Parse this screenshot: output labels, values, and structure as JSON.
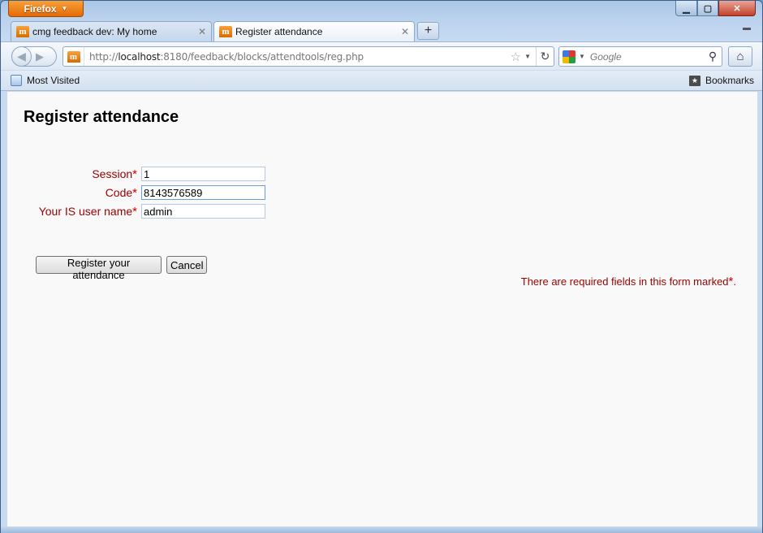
{
  "browser": {
    "menu_button": "Firefox",
    "tabs": [
      {
        "title": "cmg feedback dev: My home",
        "active": false
      },
      {
        "title": "Register attendance",
        "active": true
      }
    ],
    "new_tab_label": "+",
    "url": {
      "prefix": "http://",
      "host": "localhost",
      "rest": ":8180/feedback/blocks/attendtools/reg.php"
    },
    "search_placeholder": "Google",
    "bookmarks_toolbar": {
      "most_visited": "Most Visited",
      "bookmarks": "Bookmarks"
    }
  },
  "page": {
    "title": "Register attendance",
    "form": {
      "fields": [
        {
          "label": "Session",
          "value": "1"
        },
        {
          "label": "Code",
          "value": "8143576589"
        },
        {
          "label": "Your IS user name",
          "value": "admin"
        }
      ],
      "required_marker": "*",
      "submit_label": "Register your attendance",
      "cancel_label": "Cancel",
      "required_note": "There are required fields in this form marked",
      "required_note_end": "."
    }
  },
  "colors": {
    "required_text": "#990000",
    "required_marker": "#cc0000",
    "firefox_button": "#e66a05"
  },
  "icons": {
    "site_favicon": "moodle-icon",
    "back": "back-arrow-icon",
    "forward": "forward-arrow-icon",
    "bookmark_star": "star-icon",
    "reload": "reload-icon",
    "search_engine": "google-icon",
    "search_go": "magnifier-icon",
    "home": "home-icon"
  }
}
